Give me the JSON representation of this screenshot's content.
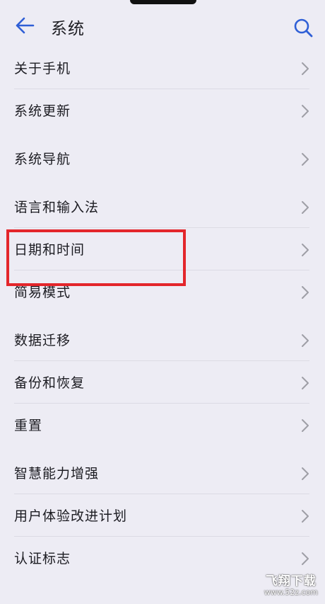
{
  "header": {
    "title": "系统",
    "back_icon": "arrow-left-icon",
    "search_icon": "search-icon"
  },
  "menu": {
    "groups": [
      {
        "items": [
          {
            "label": "关于手机"
          },
          {
            "label": "系统更新"
          }
        ]
      },
      {
        "items": [
          {
            "label": "系统导航"
          }
        ]
      },
      {
        "items": [
          {
            "label": "语言和输入法"
          },
          {
            "label": "日期和时间"
          },
          {
            "label": "简易模式"
          }
        ]
      },
      {
        "items": [
          {
            "label": "数据迁移"
          },
          {
            "label": "备份和恢复"
          },
          {
            "label": "重置"
          }
        ]
      },
      {
        "items": [
          {
            "label": "智慧能力增强"
          },
          {
            "label": "用户体验改进计划"
          },
          {
            "label": "认证标志"
          }
        ]
      }
    ]
  },
  "highlight": {
    "target": "日期和时间",
    "color": "#e3262b"
  },
  "watermark": {
    "main": "飞翔下载",
    "sub": "www.52z.com"
  },
  "colors": {
    "accent": "#2f5fd6",
    "background": "#edecf4",
    "text": "#1c1c22"
  }
}
